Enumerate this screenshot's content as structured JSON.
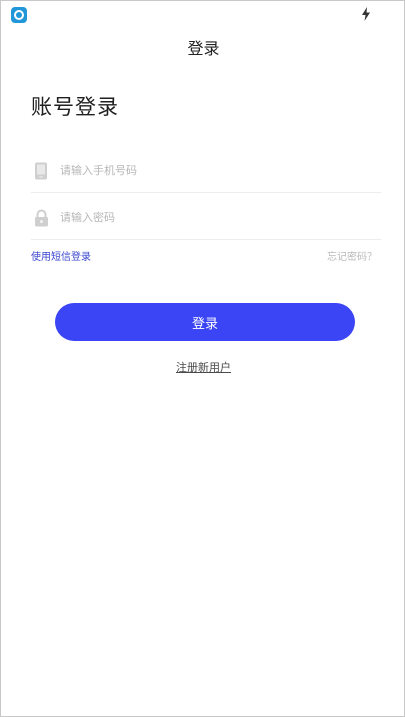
{
  "header": {
    "title": "登录"
  },
  "status_bar": {
    "app_icon": "app-logo-icon",
    "charging_icon": "bolt-icon"
  },
  "page": {
    "heading": "账号登录"
  },
  "form": {
    "phone": {
      "placeholder": "请输入手机号码",
      "value": "",
      "icon": "phone-icon"
    },
    "password": {
      "placeholder": "请输入密码",
      "value": "",
      "icon": "lock-icon"
    }
  },
  "links": {
    "sms_login": "使用短信登录",
    "forgot_password": "忘记密码？",
    "register": "注册新用户"
  },
  "actions": {
    "login_label": "登录"
  },
  "colors": {
    "primary": "#3b45f5",
    "link": "#3b47cf",
    "muted": "#b9b9b9"
  }
}
